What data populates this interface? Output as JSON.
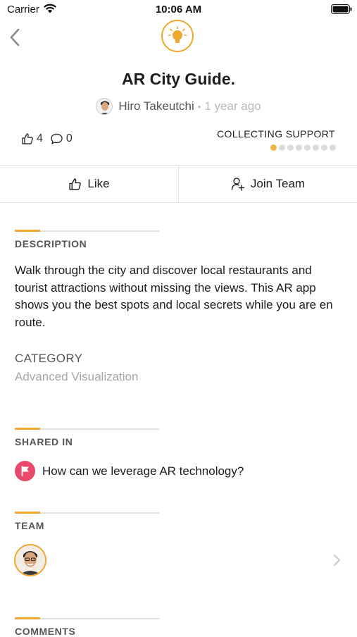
{
  "status_bar": {
    "carrier": "Carrier",
    "time": "10:06 AM",
    "wifi_icon": "wifi-icon",
    "battery_icon": "battery-icon"
  },
  "header": {
    "back_icon": "chevron-left-icon",
    "badge_icon": "lightbulb-icon",
    "accent_color": "#f0a830"
  },
  "idea": {
    "title": "AR City Guide.",
    "author": "Hiro Takeutchi",
    "separator": "•",
    "posted": "1 year ago",
    "likes": "4",
    "comments": "0",
    "status": "COLLECTING SUPPORT",
    "progress": {
      "filled": 1,
      "total": 8
    }
  },
  "actions": {
    "like_label": "Like",
    "join_label": "Join Team"
  },
  "description": {
    "heading": "DESCRIPTION",
    "text": "Walk through the city and discover local restaurants and tourist attractions without missing the views. This AR app shows you the best spots and local secrets while you are en route.",
    "category_label": "CATEGORY",
    "category_value": "Advanced Visualization"
  },
  "shared_in": {
    "heading": "SHARED IN",
    "challenge": "How can we leverage AR technology?",
    "flag_color": "#e9496a"
  },
  "team": {
    "heading": "TEAM"
  },
  "comments": {
    "heading": "COMMENTS"
  }
}
